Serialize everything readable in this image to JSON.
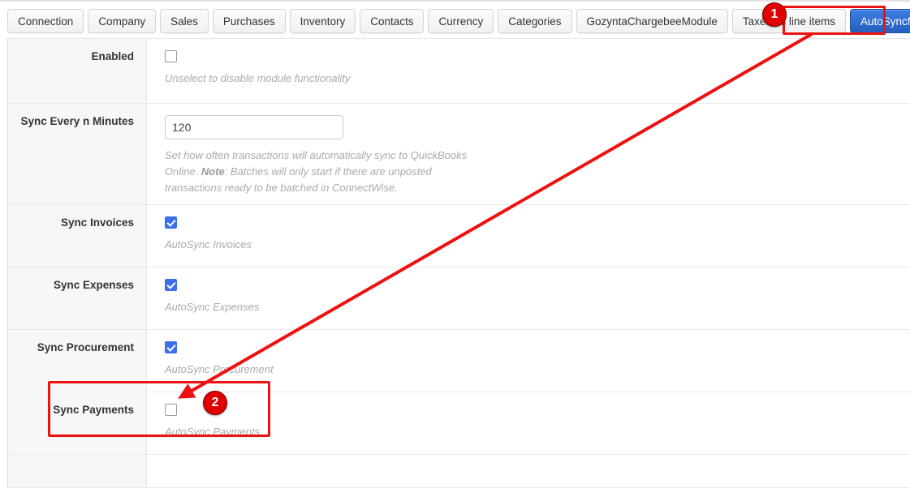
{
  "tabs": [
    {
      "label": "Connection",
      "active": false
    },
    {
      "label": "Company",
      "active": false
    },
    {
      "label": "Sales",
      "active": false
    },
    {
      "label": "Purchases",
      "active": false
    },
    {
      "label": "Inventory",
      "active": false
    },
    {
      "label": "Contacts",
      "active": false
    },
    {
      "label": "Currency",
      "active": false
    },
    {
      "label": "Categories",
      "active": false
    },
    {
      "label": "GozyntaChargebeeModule",
      "active": false
    },
    {
      "label": "Taxes as line items",
      "active": false
    },
    {
      "label": "AutoSyncModule",
      "active": true
    }
  ],
  "form": {
    "rows": [
      {
        "label": "Enabled",
        "control": "checkbox",
        "checked": false,
        "help_prefix": "Unselect to disable module functionality",
        "help_bold": "",
        "help_suffix": ""
      },
      {
        "label": "Sync Every n Minutes",
        "control": "text",
        "value": "120",
        "help_prefix": "Set how often transactions will automatically sync to QuickBooks Online. ",
        "help_bold": "Note",
        "help_suffix": ": Batches will only start if there are unposted transactions ready to be batched in ConnectWise."
      },
      {
        "label": "Sync Invoices",
        "control": "checkbox",
        "checked": true,
        "help_prefix": "AutoSync Invoices",
        "help_bold": "",
        "help_suffix": ""
      },
      {
        "label": "Sync Expenses",
        "control": "checkbox",
        "checked": true,
        "help_prefix": "AutoSync Expenses",
        "help_bold": "",
        "help_suffix": ""
      },
      {
        "label": "Sync Procurement",
        "control": "checkbox",
        "checked": true,
        "help_prefix": "AutoSync Procurement",
        "help_bold": "",
        "help_suffix": ""
      },
      {
        "label": "Sync Payments",
        "control": "checkbox",
        "checked": false,
        "help_prefix": "AutoSync Payments",
        "help_bold": "",
        "help_suffix": ""
      }
    ]
  },
  "annotations": {
    "color": "#ee1111",
    "badges": [
      {
        "number": "1",
        "target": "autosyncmodule-tab"
      },
      {
        "number": "2",
        "target": "sync-payments-checkbox"
      }
    ]
  },
  "colors": {
    "accent_checkbox": "#3b6fe8",
    "active_tab": "#2f6fd0",
    "annotation_red": "#ee1111",
    "label_background": "#f7f7f7"
  }
}
